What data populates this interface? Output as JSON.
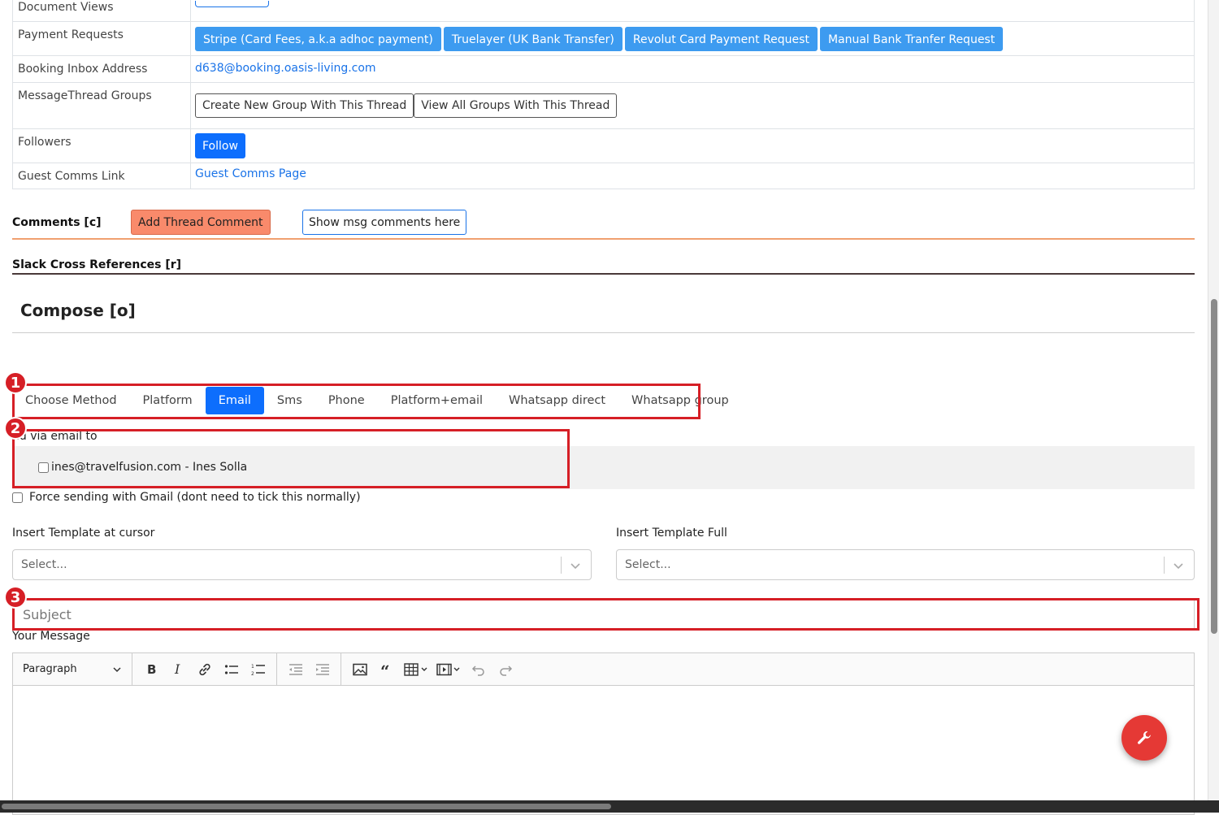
{
  "info_table": {
    "document_views": {
      "label": "Document Views"
    },
    "payment_requests": {
      "label": "Payment Requests",
      "buttons": [
        "Stripe (Card Fees, a.k.a adhoc payment)",
        "Truelayer (UK Bank Transfer)",
        "Revolut Card Payment Request",
        "Manual Bank Tranfer Request"
      ]
    },
    "booking_inbox": {
      "label": "Booking Inbox Address",
      "value": "d638@booking.oasis-living.com"
    },
    "messagethread_groups": {
      "label": "MessageThread Groups",
      "create_label": "Create New Group With This Thread",
      "view_label": "View All Groups With This Thread"
    },
    "followers": {
      "label": "Followers",
      "follow_label": "Follow"
    },
    "guest_comms": {
      "label": "Guest Comms Link",
      "link_text": "Guest Comms Page"
    }
  },
  "comments": {
    "title": "Comments [c]",
    "add_label": "Add Thread Comment",
    "show_label": "Show msg comments here"
  },
  "slack": {
    "title": "Slack Cross References [r]"
  },
  "compose": {
    "title": "Compose [o]",
    "methods": [
      "Choose Method",
      "Platform",
      "Email",
      "Sms",
      "Phone",
      "Platform+email",
      "Whatsapp direct",
      "Whatsapp group"
    ],
    "active_method": "Email",
    "send_via_label": "nd via email to",
    "recipient": "ines@travelfusion.com - Ines Solla",
    "force_gmail_label": "Force sending with Gmail (dont need to tick this normally)",
    "template_cursor_label": "Insert Template at cursor",
    "template_full_label": "Insert Template Full",
    "select_placeholder": "Select...",
    "subject_placeholder": "Subject",
    "message_label": "Your Message",
    "paragraph_label": "Paragraph"
  },
  "annotations": [
    "1",
    "2",
    "3"
  ],
  "colors": {
    "primary": "#0d6efd",
    "info_button": "#3d9bf0",
    "comment_button": "#f98a6b",
    "annotation": "#d61f26",
    "fab": "#e53935"
  },
  "icons": {
    "fab": "wrench-icon",
    "toolbar": [
      "bold-icon",
      "italic-icon",
      "link-icon",
      "bullet-list-icon",
      "numbered-list-icon",
      "outdent-icon",
      "indent-icon",
      "image-icon",
      "blockquote-icon",
      "table-icon",
      "media-icon",
      "undo-icon",
      "redo-icon"
    ]
  }
}
